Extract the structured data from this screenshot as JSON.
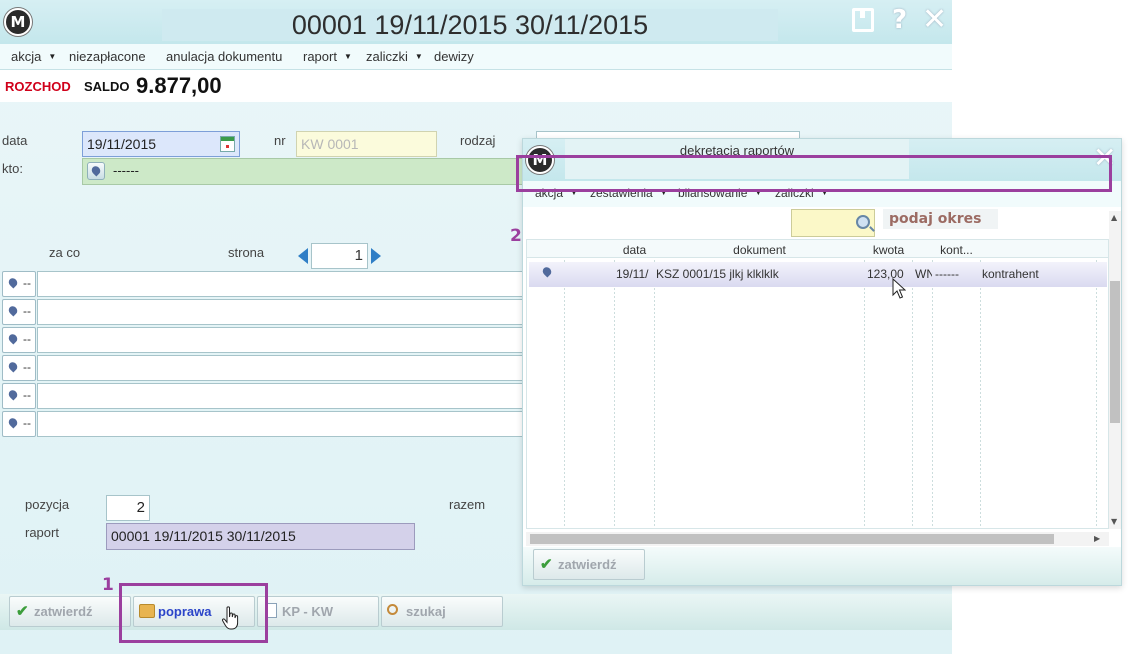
{
  "main": {
    "logo_text": "M",
    "title": "00001 19/11/2015 30/11/2015",
    "menu": [
      {
        "label": "akcja",
        "has_dropdown": true
      },
      {
        "label": "niezapłacone",
        "has_dropdown": false
      },
      {
        "label": "anulacja dokumentu",
        "has_dropdown": false
      },
      {
        "label": "raport",
        "has_dropdown": true
      },
      {
        "label": "zaliczki",
        "has_dropdown": true
      },
      {
        "label": "dewizy",
        "has_dropdown": false
      }
    ],
    "doc_type": "ROZCHOD",
    "saldo_label": "SALDO",
    "saldo_value": "9.877,00",
    "form": {
      "data_label": "data",
      "data_value": "19/11/2015",
      "nr_label": "nr",
      "nr_placeholder": "KW 0001",
      "rodzaj_label": "rodzaj",
      "kto_label": "kto:",
      "kto_value": "------",
      "za_co_label": "za co",
      "strona_label": "strona",
      "strona_value": "1",
      "item_dash": "--",
      "pozycja_label": "pozycja",
      "pozycja_value": "2",
      "razem_label": "razem",
      "raport_label": "raport",
      "raport_value": "00001 19/11/2015 30/11/2015"
    },
    "buttons": {
      "zatwierdz": "zatwierdź",
      "poprawa": "poprawa",
      "kp_kw": "KP - KW",
      "szukaj": "szukaj"
    }
  },
  "popup": {
    "logo_text": "M",
    "title": "dekretacja raportów",
    "menu": [
      {
        "label": "akcja",
        "has_dropdown": true
      },
      {
        "label": "zestawienia",
        "has_dropdown": true
      },
      {
        "label": "bilansowanie",
        "has_dropdown": true
      },
      {
        "label": "zaliczki",
        "has_dropdown": true
      }
    ],
    "search_button": "podaj okres",
    "columns": [
      "data",
      "dokument",
      "kwota",
      "kont..."
    ],
    "rows": [
      {
        "data": "19/11/",
        "dokument": "KSZ 0001/15 jlkj klklklk",
        "kwota": "123,00",
        "wn": "WN",
        "kont": "------",
        "kontrahent": "kontrahent"
      }
    ],
    "confirm_button": "zatwierdź"
  },
  "annotations": {
    "first": "1",
    "second": "2"
  },
  "colors": {
    "highlight": "#9b3f9e",
    "doc_type": "#d0001a",
    "poprawa_text": "#2b45c9"
  }
}
